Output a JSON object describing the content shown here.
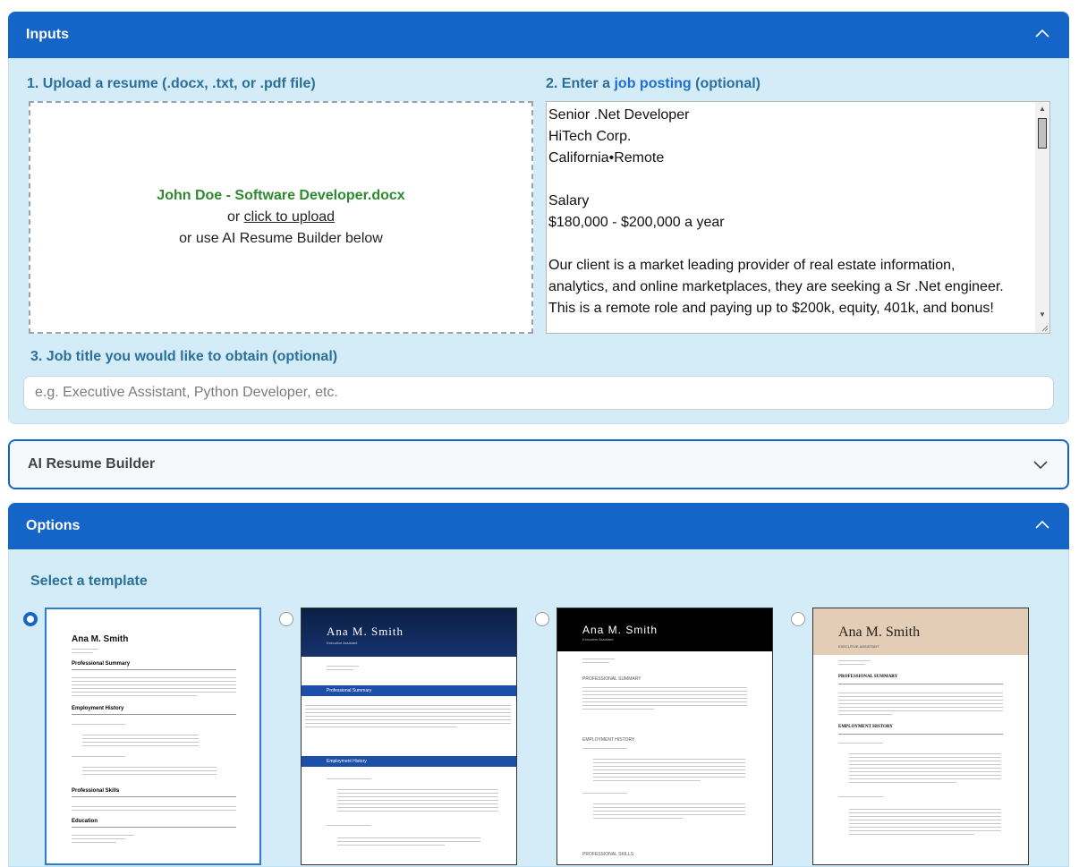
{
  "inputs_panel": {
    "title": "Inputs"
  },
  "upload": {
    "label": "1. Upload a resume (.docx, .txt, or .pdf file)",
    "filename": "John Doe - Software Developer.docx",
    "or_text": "or ",
    "upload_link": "click to upload",
    "builder_text": "or use AI Resume Builder below"
  },
  "job_posting": {
    "label_prefix": "2. Enter a ",
    "label_link": "job posting",
    "label_suffix": " (optional)",
    "lines": [
      "Senior .Net Developer",
      "HiTech Corp.",
      "California•Remote",
      "",
      "Salary",
      "$180,000 - $200,000 a year",
      "",
      "Our client is a market leading provider of real estate information,",
      "analytics, and online marketplaces, they are seeking a Sr .Net engineer.",
      "This is a remote role and paying up to $200k, equity, 401k, and bonus!"
    ]
  },
  "job_title": {
    "label": "3. Job title you would like to obtain (optional)",
    "placeholder": "e.g. Executive Assistant, Python Developer, etc."
  },
  "builder_panel": {
    "title": "AI Resume Builder"
  },
  "options_panel": {
    "title": "Options",
    "select_template_label": "Select a template"
  },
  "templates": [
    {
      "name": "Ana M. Smith",
      "subtitle": "Executive Assistant",
      "section1": "Professional Summary",
      "section2": "Employment History",
      "section3": "Professional Skills",
      "section4": "Education",
      "selected": true
    },
    {
      "name": "Ana M. Smith",
      "subtitle": "Executive Assistant",
      "section1": "Professional Summary",
      "section2": "Employment History",
      "selected": false
    },
    {
      "name": "Ana M. Smith",
      "subtitle": "Executive Assistant",
      "section1": "PROFESSIONAL SUMMARY",
      "section2": "EMPLOYMENT HISTORY",
      "section3": "PROFESSIONAL SKILLS",
      "selected": false
    },
    {
      "name": "Ana M. Smith",
      "subtitle": "EXECUTIVE ASSISTANT",
      "section1": "PROFESSIONAL SUMMARY",
      "section2": "EMPLOYMENT HISTORY",
      "selected": false
    }
  ],
  "colors": {
    "accent": "#1565c8",
    "panel_bg": "#d3ecf8",
    "label": "#2b6f9a",
    "file_green": "#2e8a2e"
  }
}
